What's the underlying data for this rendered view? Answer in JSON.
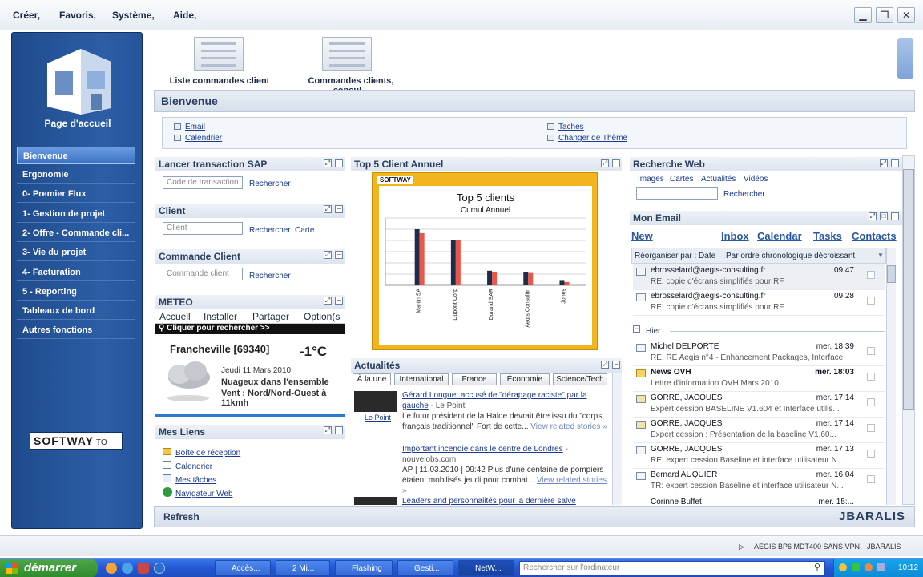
{
  "menu": [
    "Créer,",
    "Favoris,",
    "Système,",
    "Aide,"
  ],
  "window_controls": {
    "minimize": "▁",
    "restore": "❐",
    "close": "✕"
  },
  "leftnav": {
    "title": "Page d'accueil",
    "items": [
      "Bienvenue",
      "Ergonomie",
      "0- Premier Flux",
      "1- Gestion de projet",
      "2- Offre - Commande cli...",
      "3- Vie du projet",
      "4- Facturation",
      "5 - Reporting",
      "Tableaux de bord",
      "Autres fonctions"
    ],
    "logo": "SOFTWAY",
    "logo_suffix": "TO"
  },
  "quick": [
    "Liste commandes client",
    "Commandes clients, consul..."
  ],
  "welcome": {
    "title": "Bienvenue",
    "links_left": [
      "Email",
      "Calendrier"
    ],
    "links_right": [
      "Taches",
      "Changer de Thème"
    ]
  },
  "sap": {
    "title": "Lancer transaction SAP",
    "placeholder": "Code de transaction",
    "button": "Rechercher"
  },
  "client": {
    "title": "Client",
    "placeholder": "Client",
    "button": "Rechercher",
    "button2": "Carte"
  },
  "commande": {
    "title": "Commande Client",
    "placeholder": "Commande client",
    "button": "Rechercher"
  },
  "meteo": {
    "title": "METEO",
    "toolbar": [
      "Accueil",
      "Installer",
      "Partager",
      "Option(s"
    ],
    "search": "Cliquer pour rechercher >>",
    "city": "Francheville [69340]",
    "temp": "-1°C",
    "date": "Jeudi 11 Mars 2010",
    "desc": "Nuageux dans l'ensemble",
    "wind": "Vent : Nord/Nord-Ouest à 11kmh"
  },
  "liens": {
    "title": "Mes Liens",
    "items": [
      "Boîte de réception",
      "Calendrier",
      "Mes tâches",
      "Navigateur Web"
    ]
  },
  "top5": {
    "title": "Top 5 Client Annuel",
    "brand": "SOFTWAY"
  },
  "chart_data": {
    "type": "bar",
    "title": "Top 5 clients",
    "subtitle": "Cumul Annuel",
    "categories": [
      "Martin SA",
      "Dupont Corp",
      "Durand SAR",
      "Aegis Consultin",
      "Jones"
    ],
    "series": [
      {
        "values": [
          100,
          80,
          26,
          24,
          8
        ]
      },
      {
        "values": [
          93,
          80,
          23,
          22,
          6
        ]
      }
    ],
    "colors": [
      "#1f2d4c",
      "#e8574a"
    ],
    "ylim": [
      0,
      120
    ],
    "grid": true
  },
  "actu": {
    "title": "Actualités",
    "tabs": [
      "À la une",
      "International",
      "France",
      "Économie",
      "Science/Tech"
    ],
    "items": [
      {
        "headline": "Gérard Longuet accusé de \"dérapage raciste\" par la gauche",
        "source": " - Le Point",
        "body": "Le futur président de la Halde devrait être issu du \"corps français traditionnel\"   Fort de cette...",
        "related": "View related stories »",
        "thumb": "Le Point"
      },
      {
        "headline": "Important incendie dans le centre de Londres",
        "source": " - nouvelobs.com",
        "body": "AP | 11.03.2010 | 09:42 Plus d'une centaine de pompiers étaient mobilisés jeudi pour combat...",
        "related": "View related stories »"
      },
      {
        "headline": "Leaders and personnalités pour la dernière salve d'Europe"
      }
    ]
  },
  "web": {
    "title": "Recherche Web",
    "tabs": [
      "Images",
      "Cartes",
      "Actualités",
      "Vidéos"
    ],
    "button": "Rechercher"
  },
  "email": {
    "title": "Mon Email",
    "nav": [
      "New",
      "Inbox",
      "Calendar",
      "Tasks",
      "Contacts"
    ],
    "sort_label": "Réorganiser par : Date",
    "sort_value": "Par ordre chronologique décroissant",
    "group": "Hier",
    "today": [
      {
        "from": "ebrosselard@aegis-consulting.fr",
        "subject": "RE: copie d'écrans simplifiés pour RF",
        "time": "09:47"
      },
      {
        "from": "ebrosselard@aegis-consulting.fr",
        "subject": "RE: copie d'écrans simplifiés pour RF",
        "time": "09:28"
      }
    ],
    "yesterday": [
      {
        "from": "Michel DELPORTE",
        "subject": "RE: RE Aegis n°4 - Enhancement Packages, Interface S...",
        "time": "mer. 18:39"
      },
      {
        "from": "News OVH",
        "subject": "Lettre d'information OVH Mars 2010",
        "time": "mer. 18:03"
      },
      {
        "from": "GORRE, JACQUES",
        "subject": "Expert cession BASELINE V1.604 et Interface utilis...",
        "time": "mer. 17:14"
      },
      {
        "from": "GORRE, JACQUES",
        "subject": "Expert cession : Présentation de la baseline V1.60...",
        "time": "mer. 17:14"
      },
      {
        "from": "GORRE, JACQUES",
        "subject": "RE: expert cession Baseline et interface utilisateur N...",
        "time": "mer. 17:13"
      },
      {
        "from": "Bernard AUQUIER",
        "subject": "TR: expert cession Baseline et interface utilisateur N...",
        "time": "mer. 16:04"
      },
      {
        "from": "Corinne Buffet",
        "subject": "",
        "time": "mer. 15:..."
      }
    ]
  },
  "footer": {
    "refresh": "Refresh",
    "user": "JBARALIS"
  },
  "status": {
    "system": "AEGIS BP6 MDT400 SANS VPN",
    "user": "JBARALIS"
  },
  "taskbar": {
    "start": "démarrer",
    "buttons": [
      "Accès...",
      "2 Mi...",
      "Flashing",
      "Gesti...",
      "NetW..."
    ],
    "search": "Rechercher sur l'ordinateur",
    "clock": "10:12"
  }
}
